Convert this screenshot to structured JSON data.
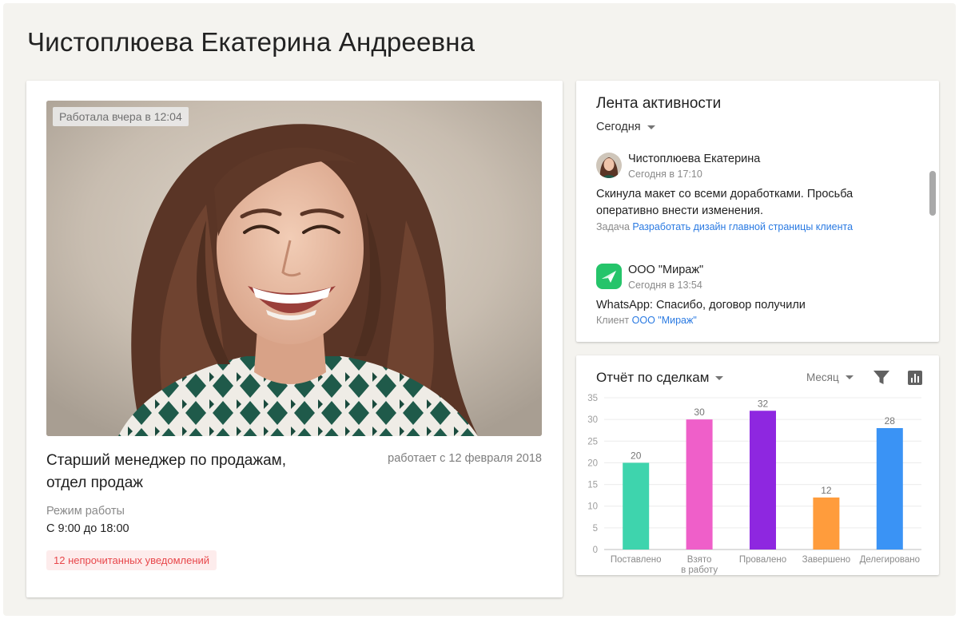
{
  "page": {
    "title": "Чистоплюева Екатерина Андреевна"
  },
  "profile": {
    "last_seen": "Работала вчера в 12:04",
    "job_title": "Старший менеджер по продажам, отдел продаж",
    "works_since": "работает с 12 февраля 2018",
    "schedule_label": "Режим работы",
    "schedule_value": "С 9:00 до 18:00",
    "notifications": "12 непрочитанных уведомлений",
    "colors": {
      "badge_bg": "#fdecec",
      "badge_text": "#e8474b"
    }
  },
  "activity": {
    "title": "Лента активности",
    "period": "Сегодня",
    "items": [
      {
        "author": "Чистоплюева Екатерина",
        "time": "Сегодня в 17:10",
        "text": "Скинула макет со всеми доработками. Просьба оперативно внести изменения.",
        "link_label": "Задача",
        "link_text": "Разработать дизайн главной страницы клиента",
        "icon": "user-avatar"
      },
      {
        "author": "ООО \"Мираж\"",
        "time": "Сегодня в 13:54",
        "text": "WhatsApp: Спасибо, договор получили",
        "link_label": "Клиент",
        "link_text": "ООО \"Мираж\"",
        "icon": "send-icon"
      }
    ]
  },
  "deals": {
    "title": "Отчёт по сделкам",
    "period": "Месяц",
    "icons": [
      "filter-icon",
      "bar-chart-icon"
    ]
  },
  "chart_data": {
    "type": "bar",
    "categories": [
      "Поставлено",
      "Взято в работу",
      "Провалено",
      "Завершено",
      "Делегировано"
    ],
    "category_lines": [
      [
        "Поставлено"
      ],
      [
        "Взято",
        "в работу"
      ],
      [
        "Провалено"
      ],
      [
        "Завершено"
      ],
      [
        "Делегировано"
      ]
    ],
    "values": [
      20,
      30,
      32,
      12,
      28
    ],
    "colors": [
      "#3ed4ad",
      "#ef5fc9",
      "#8e27e0",
      "#ff9c3c",
      "#3a93f5"
    ],
    "ylim": [
      0,
      35
    ],
    "yticks": [
      0,
      5,
      10,
      15,
      20,
      25,
      30,
      35
    ],
    "grid": true,
    "title": "",
    "xlabel": "",
    "ylabel": ""
  }
}
